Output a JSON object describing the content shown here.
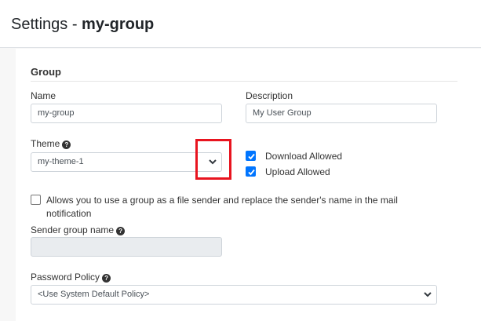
{
  "header": {
    "title_prefix": "Settings - ",
    "title_group": "my-group"
  },
  "section": {
    "title": "Group"
  },
  "form": {
    "name_label": "Name",
    "name_value": "my-group",
    "description_label": "Description",
    "description_value": "My User Group",
    "theme_label": "Theme",
    "theme_value": "my-theme-1",
    "download_allowed_label": "Download Allowed",
    "download_allowed_checked": true,
    "upload_allowed_label": "Upload Allowed",
    "upload_allowed_checked": true,
    "file_sender_label": "Allows you to use a group as a file sender and replace the sender's name in the mail notification",
    "file_sender_checked": false,
    "sender_group_name_label": "Sender group name",
    "sender_group_name_value": "",
    "password_policy_label": "Password Policy",
    "password_policy_value": "<Use System Default Policy>"
  },
  "icons": {
    "help": "question-circle-icon",
    "caret": "chevron-down-icon",
    "check": "check-icon"
  },
  "colors": {
    "checkbox_accent": "#0075ff",
    "highlight": "#e8141f",
    "disabled_bg": "#e9ecef"
  }
}
